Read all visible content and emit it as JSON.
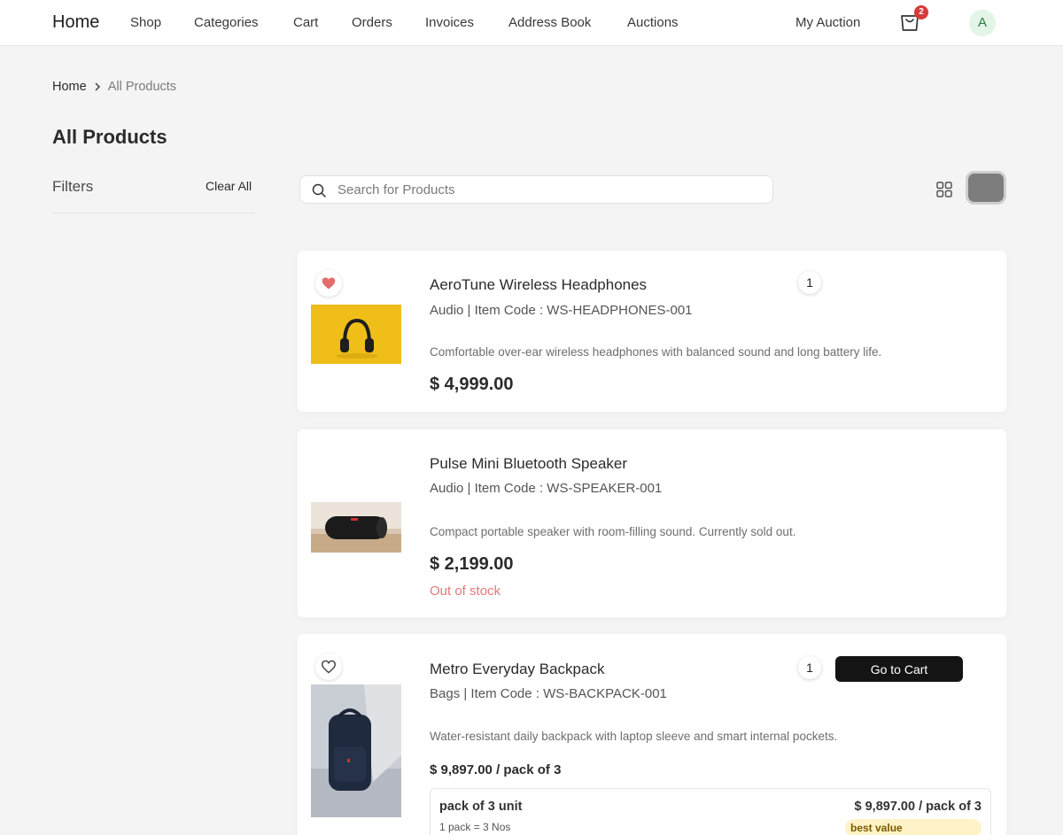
{
  "nav": {
    "brand": "Home",
    "links": [
      "Shop",
      "Categories",
      "Cart",
      "Orders",
      "Invoices",
      "Address Book",
      "Auctions"
    ],
    "my_auction": "My Auction",
    "cart_count": "2",
    "avatar_initial": "A"
  },
  "breadcrumb": {
    "home": "Home",
    "current": "All Products"
  },
  "page_title": "All Products",
  "filters": {
    "title": "Filters",
    "clear_label": "Clear All"
  },
  "search": {
    "placeholder": "Search for Products",
    "value": ""
  },
  "products": [
    {
      "name": "AeroTune Wireless Headphones",
      "meta": "Audio | Item Code : WS-HEADPHONES-001",
      "description": "Comfortable over-ear wireless headphones with balanced sound and long battery life.",
      "price": "$ 4,999.00",
      "quantity": "1",
      "wishlisted": true
    },
    {
      "name": "Pulse Mini Bluetooth Speaker",
      "meta": "Audio | Item Code : WS-SPEAKER-001",
      "description": "Compact portable speaker with room-filling sound. Currently sold out.",
      "price": "$ 2,199.00",
      "stock_status": "Out of stock"
    },
    {
      "name": "Metro Everyday Backpack",
      "meta": "Bags | Item Code : WS-BACKPACK-001",
      "description": "Water-resistant daily backpack with laptop sleeve and smart internal pockets.",
      "price": "$ 9,897.00 / pack of 3",
      "quantity": "1",
      "cart_button": "Go to Cart",
      "wishlisted": false,
      "pack_option": {
        "title": "pack of 3 unit",
        "subtitle": "1 pack = 3 Nos",
        "price": "$ 9,897.00 / pack of 3",
        "badge": "best value"
      }
    }
  ],
  "colors": {
    "accent_dark": "#141414",
    "out_of_stock": "#e07a7a",
    "badge": "#d63a3a",
    "heart": "#e46b6b"
  }
}
